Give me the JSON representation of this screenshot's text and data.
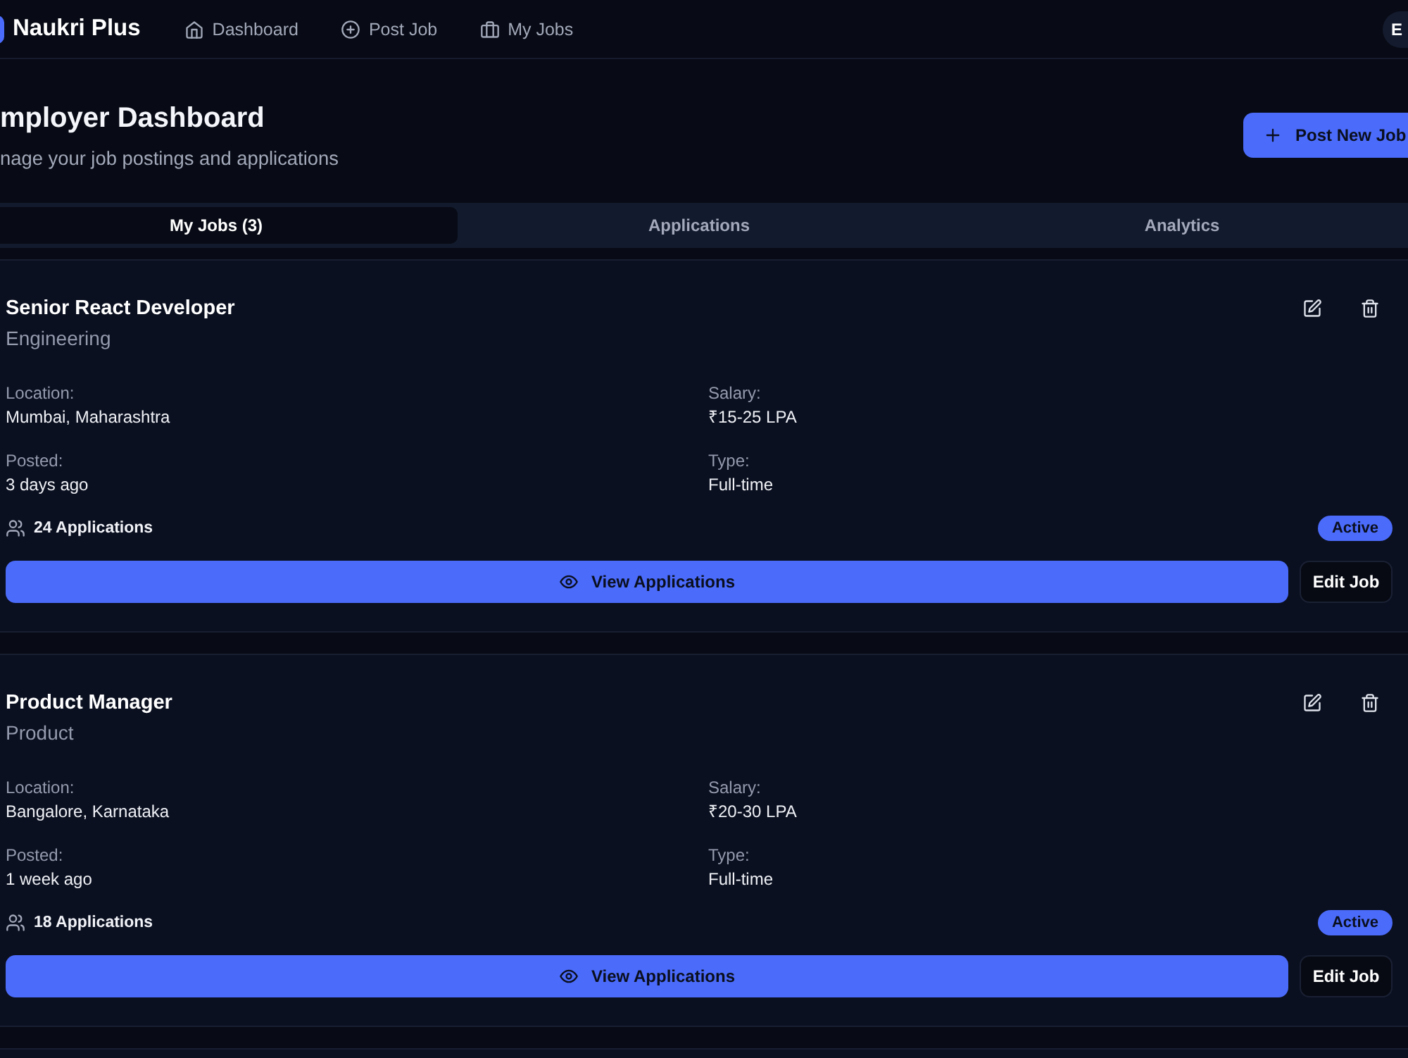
{
  "header": {
    "logo": "Naukri Plus",
    "nav": [
      {
        "label": "Dashboard"
      },
      {
        "label": "Post Job"
      },
      {
        "label": "My Jobs"
      }
    ],
    "avatar": "E"
  },
  "page": {
    "title": "mployer Dashboard",
    "subtitle": "nage your job postings and applications",
    "primary_action": "Post New Job"
  },
  "tabs": [
    {
      "label": "My Jobs (3)",
      "selected": true
    },
    {
      "label": "Applications",
      "selected": false
    },
    {
      "label": "Analytics",
      "selected": false
    }
  ],
  "jobs": [
    {
      "title": "Senior React Developer",
      "department": "Engineering",
      "fields": [
        {
          "label": "Location:",
          "value": "Mumbai, Maharashtra"
        },
        {
          "label": "Salary:",
          "value": "₹15-25 LPA"
        },
        {
          "label": "Posted:",
          "value": "3 days ago"
        },
        {
          "label": "Type:",
          "value": "Full-time"
        }
      ],
      "applications": "24 Applications",
      "status": "Active",
      "view_button": "View Applications",
      "edit_button": "Edit Job"
    },
    {
      "title": "Product Manager",
      "department": "Product",
      "fields": [
        {
          "label": "Location:",
          "value": "Bangalore, Karnataka"
        },
        {
          "label": "Salary:",
          "value": "₹20-30 LPA"
        },
        {
          "label": "Posted:",
          "value": "1 week ago"
        },
        {
          "label": "Type:",
          "value": "Full-time"
        }
      ],
      "applications": "18 Applications",
      "status": "Active",
      "view_button": "View Applications",
      "edit_button": "Edit Job"
    }
  ]
}
